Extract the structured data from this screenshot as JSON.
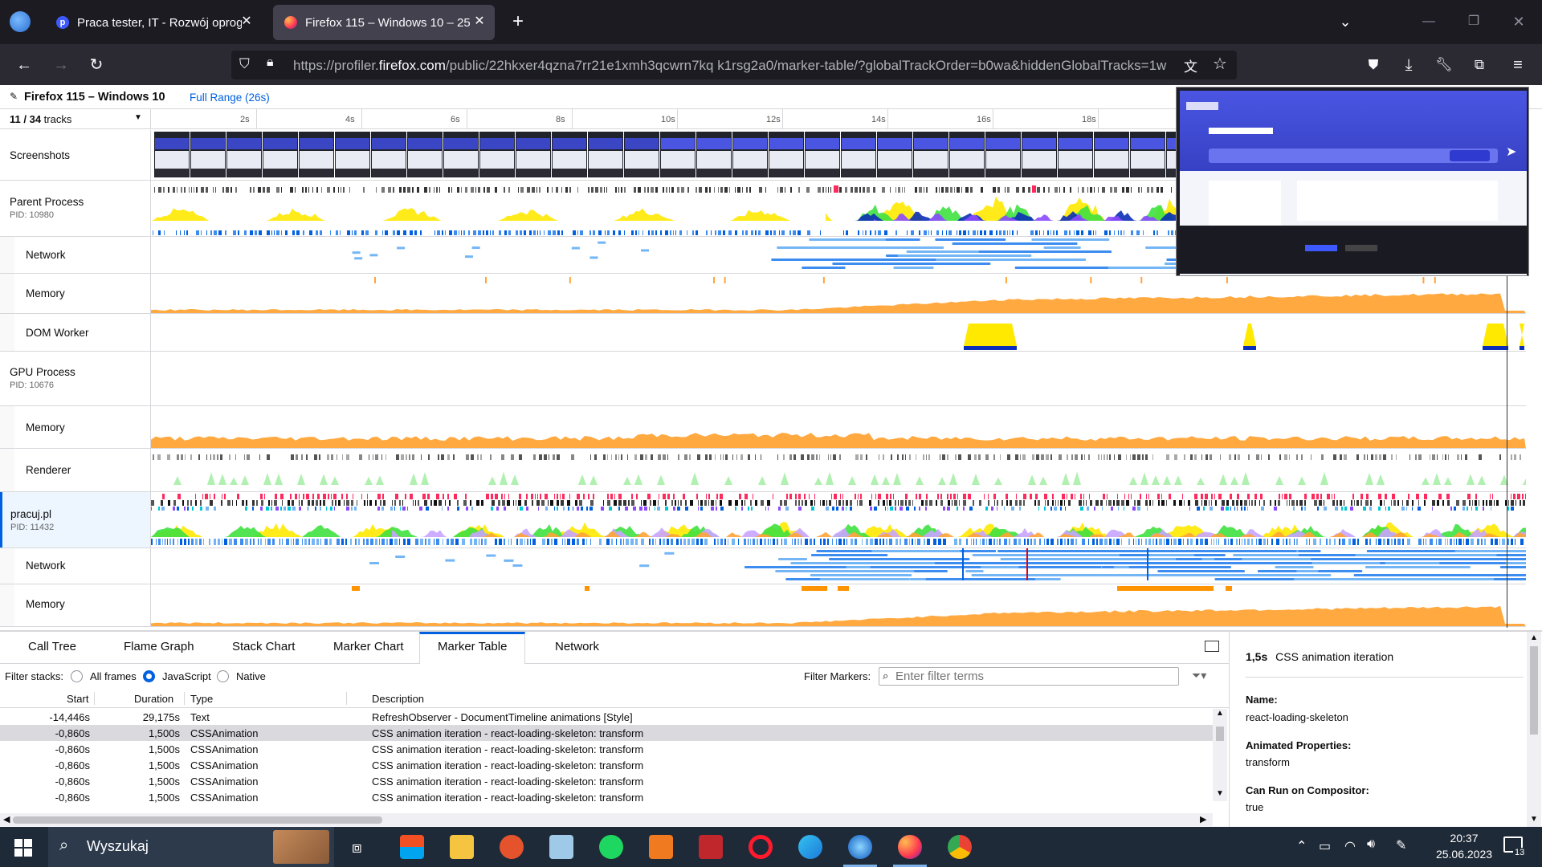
{
  "browser": {
    "tabs": [
      {
        "title": "Praca tester, IT - Rozwój oprogr",
        "favicon": "pracuj-icon"
      },
      {
        "title": "Firefox 115 – Windows 10 – 25.",
        "favicon": "firefox-icon"
      }
    ],
    "url_prefix": "https://profiler.",
    "url_domain": "firefox.com",
    "url_rest": "/public/22hkxer4qzna7rr21e1xmh3qcwrn7kq k1rsg2a0/marker-table/?globalTrackOrder=b0wa&hiddenGlobalTracks=1w"
  },
  "profiler": {
    "profile_name": "Firefox 115 – Windows 10",
    "range_label": "Full Range (26s)",
    "track_count_visible": "11",
    "track_count_total": " / 34",
    "track_count_suffix": " tracks",
    "ticks": [
      "2s",
      "4s",
      "6s",
      "8s",
      "10s",
      "12s",
      "14s",
      "16s",
      "18s"
    ],
    "tracks": [
      {
        "name": "Screenshots",
        "pid": ""
      },
      {
        "name": "Parent Process",
        "pid": "PID: 10980"
      },
      {
        "name": "Network",
        "pid": ""
      },
      {
        "name": "Memory",
        "pid": ""
      },
      {
        "name": "DOM Worker",
        "pid": ""
      },
      {
        "name": "GPU Process",
        "pid": "PID: 10676"
      },
      {
        "name": "Memory",
        "pid": ""
      },
      {
        "name": "Renderer",
        "pid": ""
      },
      {
        "name": "pracuj.pl",
        "pid": "PID: 11432"
      },
      {
        "name": "Network",
        "pid": ""
      },
      {
        "name": "Memory",
        "pid": ""
      }
    ]
  },
  "panel": {
    "tabs": [
      "Call Tree",
      "Flame Graph",
      "Stack Chart",
      "Marker Chart",
      "Marker Table",
      "Network"
    ],
    "selected_tab": "Marker Table",
    "filter_stacks_label": "Filter stacks:",
    "stack_options": [
      "All frames",
      "JavaScript",
      "Native"
    ],
    "selected_stack": "JavaScript",
    "filter_markers_label": "Filter Markers:",
    "filter_placeholder": "Enter filter terms",
    "columns": [
      "Start",
      "Duration",
      "Type",
      "Description"
    ],
    "rows": [
      {
        "start": "-14,446s",
        "duration": "29,175s",
        "type": "Text",
        "description": "RefreshObserver - DocumentTimeline animations [Style]"
      },
      {
        "start": "-0,860s",
        "duration": "1,500s",
        "type": "CSSAnimation",
        "description": "CSS animation iteration - react-loading-skeleton: transform"
      },
      {
        "start": "-0,860s",
        "duration": "1,500s",
        "type": "CSSAnimation",
        "description": "CSS animation iteration - react-loading-skeleton: transform"
      },
      {
        "start": "-0,860s",
        "duration": "1,500s",
        "type": "CSSAnimation",
        "description": "CSS animation iteration - react-loading-skeleton: transform"
      },
      {
        "start": "-0,860s",
        "duration": "1,500s",
        "type": "CSSAnimation",
        "description": "CSS animation iteration - react-loading-skeleton: transform"
      },
      {
        "start": "-0,860s",
        "duration": "1,500s",
        "type": "CSSAnimation",
        "description": "CSS animation iteration - react-loading-skeleton: transform"
      }
    ],
    "selected_row_index": 1
  },
  "sidebar": {
    "duration": "1,5s",
    "title": "CSS animation iteration",
    "fields": [
      {
        "label": "Name:",
        "value": "react-loading-skeleton"
      },
      {
        "label": "Animated Properties:",
        "value": "transform"
      },
      {
        "label": "Can Run on Compositor:",
        "value": "true"
      }
    ]
  },
  "taskbar": {
    "search_label": "Wyszukaj",
    "time": "20:37",
    "date": "25.06.2023",
    "notification_count": "13"
  },
  "colors": {
    "accent": "#0060df",
    "memory": "#ffa436",
    "cpu_yellow": "#ffe900",
    "cpu_green": "#3fe13f",
    "network_blue": "#74b6f5",
    "selected_track": "#edf6ff"
  }
}
